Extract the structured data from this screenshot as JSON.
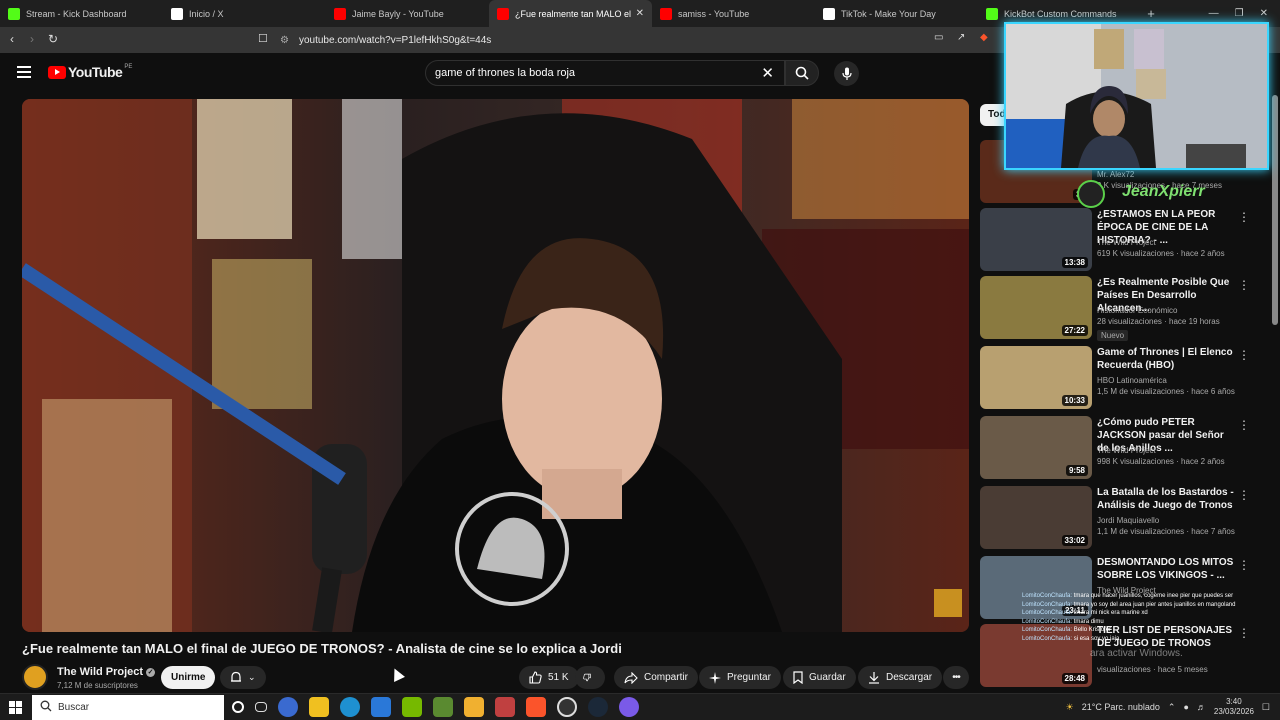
{
  "browser": {
    "tabs": [
      {
        "label": "Stream - Kick Dashboard",
        "color": "#53fc18",
        "active": false
      },
      {
        "label": "Inicio / X",
        "color": "#ffffff",
        "active": false
      },
      {
        "label": "Jaime Bayly - YouTube",
        "color": "#ff0000",
        "active": false
      },
      {
        "label": "¿Fue realmente tan MALO el",
        "color": "#ff0000",
        "active": true
      },
      {
        "label": "samiss - YouTube",
        "color": "#ff0000",
        "active": false
      },
      {
        "label": "TikTok - Make Your Day",
        "color": "#ffffff",
        "active": false
      },
      {
        "label": "KickBot Custom Commands",
        "color": "#53fc18",
        "active": false
      }
    ],
    "url": "youtube.com/watch?v=P1lefHkhS0g&t=44s"
  },
  "header": {
    "logo_text": "YouTube",
    "country": "PE",
    "search_query": "game of thrones la boda roja"
  },
  "video": {
    "title": "¿Fue realmente tan MALO el final de JUEGO DE TRONOS? - Analista de cine se lo explica a Jordi",
    "channel": "The Wild Project",
    "subscribers": "7,12 M de suscriptores",
    "join_label": "Unirme",
    "likes": "51 K",
    "share_label": "Compartir",
    "ask_label": "Preguntar",
    "save_label": "Guardar",
    "download_label": "Descargar"
  },
  "sidebar": {
    "chip": "Tod",
    "recommendations": [
      {
        "title": "",
        "channel": "Mr. Alex72",
        "meta": "9 K visualizaciones · hace 7 meses",
        "duration": "33",
        "thumb": "#5a2a1a"
      },
      {
        "title": "¿ESTAMOS EN LA PEOR ÉPOCA DE CINE DE LA HISTORIA? - ...",
        "channel": "The Wild Project",
        "meta": "619 K visualizaciones · hace 2 años",
        "duration": "13:38",
        "thumb": "#3a3f48"
      },
      {
        "title": "¿Es Realmente Posible Que Países En Desarrollo Alcancen...",
        "channel": "Historiador Económico",
        "meta": "28 visualizaciones · hace 19 horas",
        "duration": "27:22",
        "thumb": "#8a7a40",
        "badge": "Nuevo"
      },
      {
        "title": "Game of Thrones | El Elenco Recuerda (HBO)",
        "channel": "HBO Latinoamérica",
        "meta": "1,5 M de visualizaciones · hace 6 años",
        "duration": "10:33",
        "thumb": "#b8a070"
      },
      {
        "title": "¿Cómo pudo PETER JACKSON pasar del Señor de los Anillos ...",
        "channel": "The Wild Project",
        "meta": "998 K visualizaciones · hace 2 años",
        "duration": "9:58",
        "thumb": "#6a5a48"
      },
      {
        "title": "La Batalla de los Bastardos - Análisis de Juego de Tronos",
        "channel": "Jordi Maquiavello",
        "meta": "1,1 M de visualizaciones · hace 7 años",
        "duration": "33:02",
        "thumb": "#4a3c34"
      },
      {
        "title": "DESMONTANDO LOS MITOS SOBRE LOS VIKINGOS - ...",
        "channel": "The Wild Project",
        "meta": "",
        "duration": "23:11",
        "thumb": "#5a6a78"
      },
      {
        "title": "TIER LIST DE PERSONAJES DE JUEGO DE TRONOS",
        "channel": "",
        "meta": "visualizaciones · hace 5 meses",
        "duration": "28:48",
        "thumb": "#7a3a30"
      }
    ]
  },
  "overlay": {
    "streamer": "JeanXpierr",
    "chat": [
      {
        "user": "LomitoConChaufa:",
        "msg": "tmara que hacer juanillos, cogeme inee pier que puedes ser"
      },
      {
        "user": "LomitoConChaufa:",
        "msg": "tmara yo soy del area juan pier antes juanillos en mangoland"
      },
      {
        "user": "LomitoConChaufa:",
        "msg": "tmara mi nick era marine xd"
      },
      {
        "user": "LomitoConChaufa:",
        "msg": "tmara dimu"
      },
      {
        "user": "LomitoConChaufa:",
        "msg": "Bello Kristofer"
      },
      {
        "user": "LomitoConChaufa:",
        "msg": "si esa soy yo jaja"
      }
    ],
    "activate": "ara activar Windows."
  },
  "taskbar": {
    "search_placeholder": "Buscar",
    "weather": "21°C  Parc. nublado",
    "time": "3:40",
    "date": "23/03/2026"
  }
}
